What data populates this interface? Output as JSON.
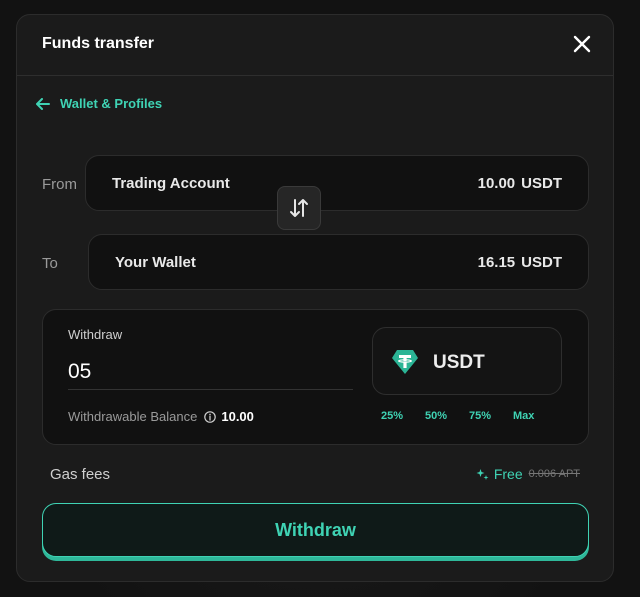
{
  "modal": {
    "title": "Funds transfer"
  },
  "back_link": {
    "label": "Wallet & Profiles"
  },
  "from": {
    "label": "From",
    "account": "Trading Account",
    "amount": "10.00",
    "currency": "USDT"
  },
  "to": {
    "label": "To",
    "account": "Your Wallet",
    "amount": "16.15",
    "currency": "USDT"
  },
  "withdraw_panel": {
    "label": "Withdraw",
    "input_value": "05",
    "balance_label": "Withdrawable Balance",
    "balance_value": "10.00",
    "token": "USDT",
    "percent_options": [
      "25%",
      "50%",
      "75%",
      "Max"
    ]
  },
  "gas": {
    "label": "Gas fees",
    "free_label": "Free",
    "original_fee": "0.006 APT"
  },
  "submit": {
    "label": "Withdraw"
  },
  "colors": {
    "accent": "#3fd3b4",
    "background": "#1b1b1b",
    "panel": "#111111",
    "tether": "#2bb596"
  },
  "icons": [
    "close-icon",
    "arrow-left-icon",
    "swap-icon",
    "info-icon",
    "tether-icon",
    "sparkle-icon"
  ]
}
